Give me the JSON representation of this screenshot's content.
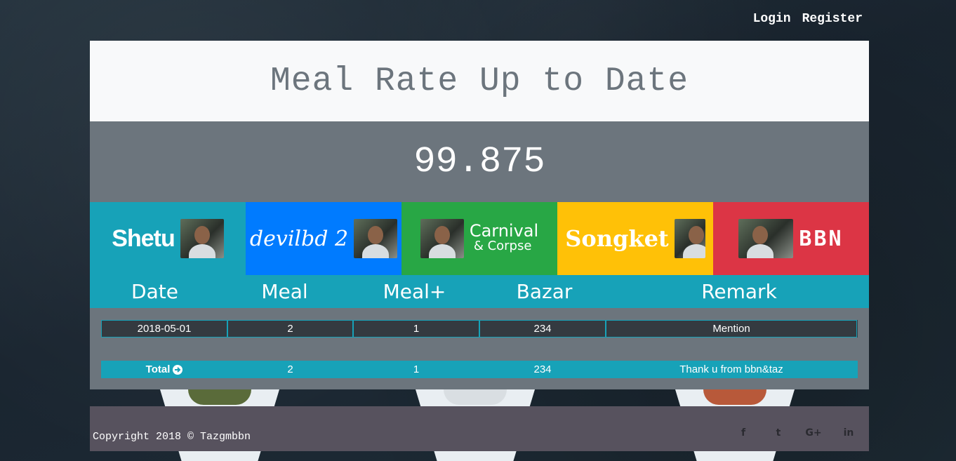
{
  "nav": {
    "login": "Login",
    "register": "Register"
  },
  "header": {
    "title": "Meal Rate Up to Date"
  },
  "meal_rate": {
    "value": "99.875"
  },
  "members": [
    {
      "logo_text": "Shetu",
      "color": "#17a2b8"
    },
    {
      "logo_text": "devilbd 2",
      "color": "#007bff"
    },
    {
      "logo_text": "Carnival",
      "logo_subtext": "& Corpse",
      "color": "#28a745"
    },
    {
      "logo_text": "Songket",
      "color": "#ffc107"
    },
    {
      "logo_text": "BBN",
      "color": "#dc3545"
    }
  ],
  "table": {
    "headers": [
      "Date",
      "Meal",
      "Meal+",
      "Bazar",
      "Remark"
    ],
    "rows": [
      {
        "date": "2018-05-01",
        "meal": "2",
        "meal_plus": "1",
        "bazar": "234",
        "remark": "Mention"
      }
    ],
    "total": {
      "label": "Total",
      "meal": "2",
      "meal_plus": "1",
      "bazar": "234",
      "remark": "Thank u from bbn&taz"
    }
  },
  "footer": {
    "copyright": "Copyright 2018 © Tazgmbbn"
  },
  "socials": [
    {
      "icon": "facebook-icon",
      "glyph": "f"
    },
    {
      "icon": "twitter-icon",
      "glyph": "t"
    },
    {
      "icon": "google-plus-icon",
      "glyph": "G+"
    },
    {
      "icon": "linkedin-icon",
      "glyph": "in"
    }
  ],
  "colors": {
    "info": "#17a2b8",
    "primary": "#007bff",
    "success": "#28a745",
    "warning": "#ffc107",
    "danger": "#dc3545",
    "secondary": "#6c757d"
  }
}
